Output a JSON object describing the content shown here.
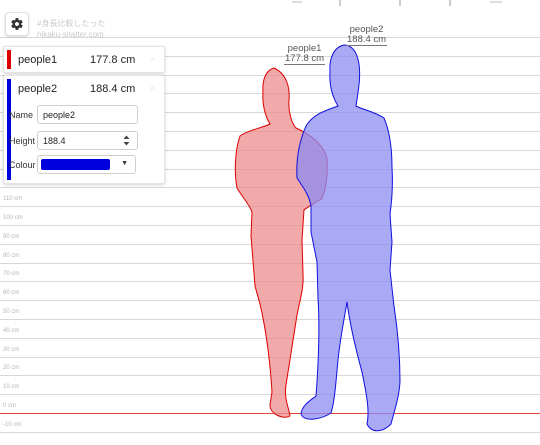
{
  "watermark": {
    "line1": "#身長比較したった",
    "line2": "hikaku-sitatter.com"
  },
  "settings_icon": "gear-icon",
  "people": [
    {
      "name": "people1",
      "height_text": "177.8 cm",
      "height_cm": 177.8,
      "color": "#dd0000",
      "figure_fill": "#ed8c8c"
    },
    {
      "name": "people2",
      "height_text": "188.4 cm",
      "height_cm": 188.4,
      "color": "#0000dd",
      "figure_fill": "#8c8cf3"
    }
  ],
  "editor": {
    "name_label": "Name",
    "name_value": "people2",
    "height_label": "Height",
    "height_value": "188.4",
    "colour_label": "Colour",
    "colour_value": "#0000dd"
  },
  "close_glyph": "×",
  "scale": {
    "unit": "cm",
    "ticks": [
      110,
      100,
      90,
      80,
      70,
      60,
      50,
      40,
      30,
      20,
      10,
      0,
      -10
    ],
    "tick_labels": [
      "110 cm",
      "100 cm",
      "90 cm",
      "80 cm",
      "70 cm",
      "60 cm",
      "50 cm",
      "40 cm",
      "30 cm",
      "20 cm",
      "10 cm",
      "0 cm",
      "-10 cm"
    ],
    "zero_line_color": "#e0483a"
  }
}
